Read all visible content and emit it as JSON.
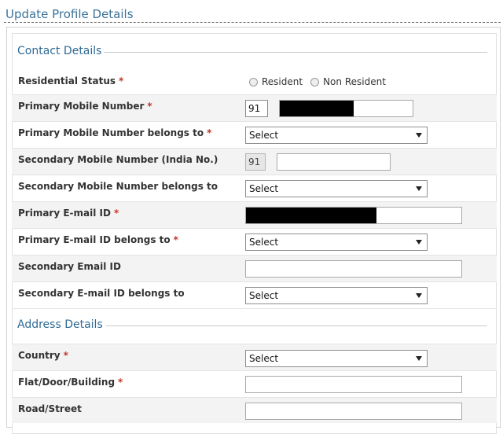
{
  "page": {
    "title": "Update Profile Details"
  },
  "contact": {
    "section_title": "Contact Details",
    "residential_status": {
      "label": "Residential Status",
      "options": [
        "Resident",
        "Non Resident"
      ]
    },
    "primary_mobile": {
      "label": "Primary Mobile Number",
      "code": "91"
    },
    "primary_mobile_belongs": {
      "label": "Primary Mobile Number belongs to",
      "value": "Select"
    },
    "secondary_mobile": {
      "label": "Secondary Mobile Number (India No.)",
      "code": "91"
    },
    "secondary_mobile_belongs": {
      "label": "Secondary Mobile Number belongs to",
      "value": "Select"
    },
    "primary_email": {
      "label": "Primary E-mail ID"
    },
    "primary_email_belongs": {
      "label": "Primary E-mail ID belongs to",
      "value": "Select"
    },
    "secondary_email": {
      "label": "Secondary Email ID"
    },
    "secondary_email_belongs": {
      "label": "Secondary E-mail ID belongs to",
      "value": "Select"
    }
  },
  "address": {
    "section_title": "Address Details",
    "country": {
      "label": "Country",
      "value": "Select"
    },
    "flat": {
      "label": "Flat/Door/Building"
    },
    "road": {
      "label": "Road/Street"
    }
  },
  "required_marker": "*"
}
